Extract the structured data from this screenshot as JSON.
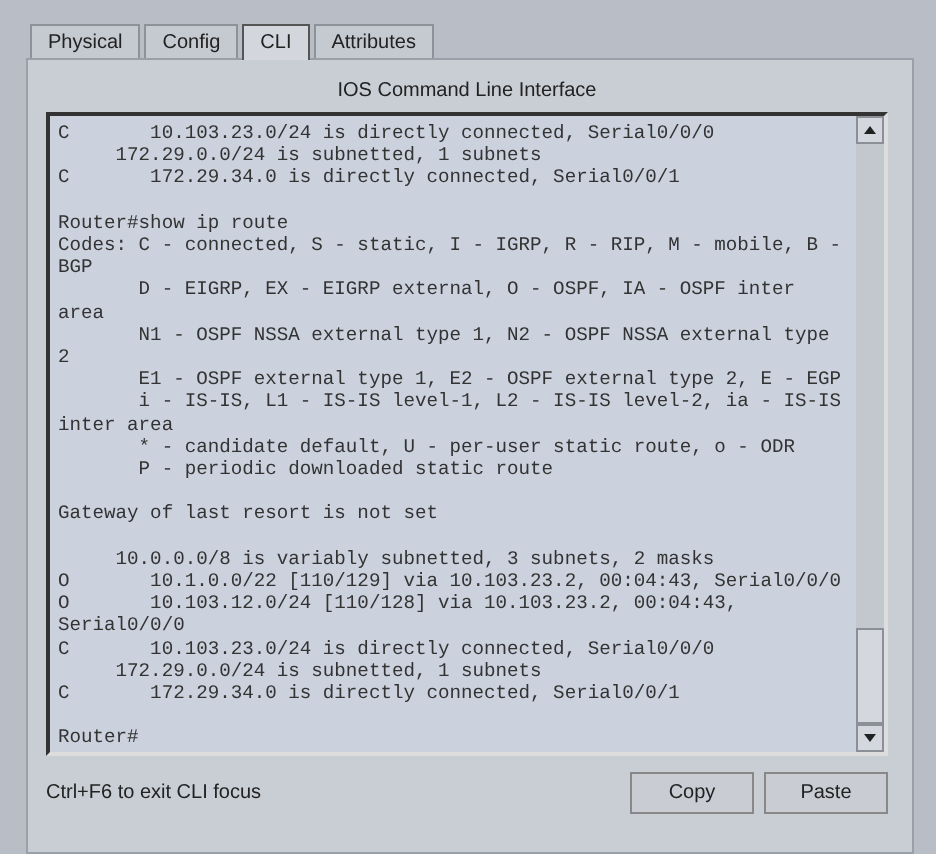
{
  "tabs": [
    {
      "label": "Physical",
      "selected": false
    },
    {
      "label": "Config",
      "selected": false
    },
    {
      "label": "CLI",
      "selected": true
    },
    {
      "label": "Attributes",
      "selected": false
    }
  ],
  "panel": {
    "title": "IOS Command Line Interface"
  },
  "terminal": {
    "blocks": [
      [
        "C       10.103.23.0/24 is directly connected, Serial0/0/0",
        "     172.29.0.0/24 is subnetted, 1 subnets",
        "C       172.29.34.0 is directly connected, Serial0/0/1"
      ],
      [
        "Router#show ip route",
        "Codes: C - connected, S - static, I - IGRP, R - RIP, M - mobile, B -",
        "BGP",
        "       D - EIGRP, EX - EIGRP external, O - OSPF, IA - OSPF inter",
        "area",
        "       N1 - OSPF NSSA external type 1, N2 - OSPF NSSA external type",
        "2",
        "       E1 - OSPF external type 1, E2 - OSPF external type 2, E - EGP",
        "       i - IS-IS, L1 - IS-IS level-1, L2 - IS-IS level-2, ia - IS-IS",
        "inter area",
        "       * - candidate default, U - per-user static route, o - ODR",
        "       P - periodic downloaded static route"
      ],
      [
        "Gateway of last resort is not set"
      ],
      [
        "     10.0.0.0/8 is variably subnetted, 3 subnets, 2 masks",
        "O       10.1.0.0/22 [110/129] via 10.103.23.2, 00:04:43, Serial0/0/0",
        "O       10.103.12.0/24 [110/128] via 10.103.23.2, 00:04:43,",
        "Serial0/0/0",
        "C       10.103.23.0/24 is directly connected, Serial0/0/0",
        "     172.29.0.0/24 is subnetted, 1 subnets",
        "C       172.29.34.0 is directly connected, Serial0/0/1"
      ],
      [
        "Router#"
      ]
    ]
  },
  "footer": {
    "hint": "Ctrl+F6 to exit CLI focus",
    "buttons": [
      "Copy",
      "Paste"
    ]
  }
}
